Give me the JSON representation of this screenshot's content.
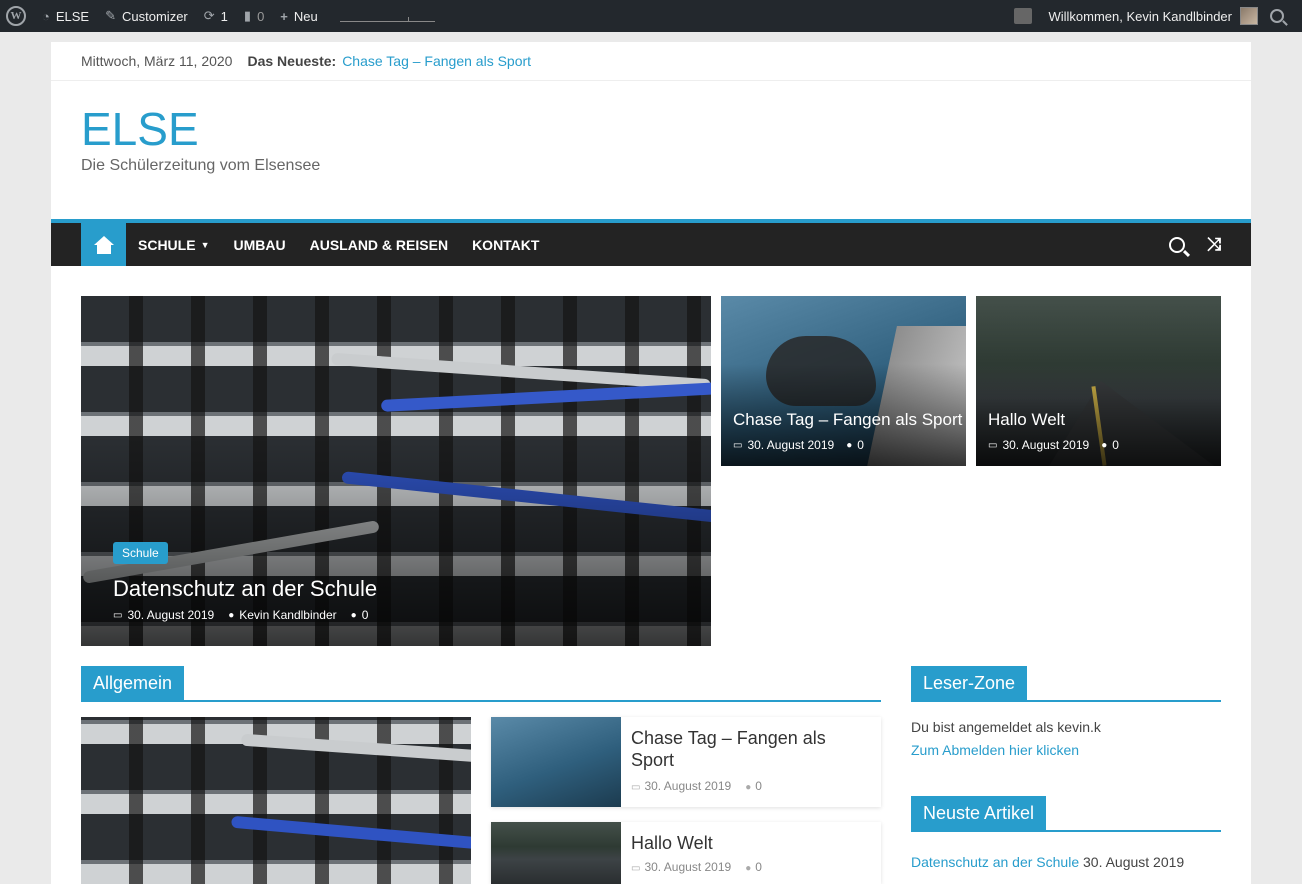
{
  "adminbar": {
    "site_name": "ELSE",
    "customizer": "Customizer",
    "updates_count": "1",
    "comments_count": "0",
    "new_label": "Neu",
    "greeting": "Willkommen, Kevin Kandlbinder"
  },
  "topbar": {
    "date": "Mittwoch, März 11, 2020",
    "news_label": "Das Neueste:",
    "news_link": "Chase Tag – Fangen als Sport"
  },
  "branding": {
    "title": "ELSE",
    "tagline": "Die Schülerzeitung vom Elsensee"
  },
  "nav": {
    "items": [
      "SCHULE",
      "UMBAU",
      "AUSLAND & REISEN",
      "KONTAKT"
    ]
  },
  "featured": {
    "main": {
      "category": "Schule",
      "title": "Datenschutz an der Schule",
      "date": "30. August 2019",
      "author": "Kevin Kandlbinder",
      "comments": "0"
    },
    "side": [
      {
        "title": "Chase Tag – Fangen als Sport",
        "date": "30. August 2019",
        "comments": "0"
      },
      {
        "title": "Hallo Welt",
        "date": "30. August 2019",
        "comments": "0"
      }
    ]
  },
  "section": {
    "title": "Allgemein",
    "posts": [
      {
        "title": "Chase Tag – Fangen als Sport",
        "date": "30. August 2019",
        "comments": "0"
      },
      {
        "title": "Hallo Welt",
        "date": "30. August 2019",
        "comments": "0"
      }
    ]
  },
  "sidebar": {
    "reader_zone_title": "Leser-Zone",
    "logged_in_text": "Du bist angemeldet als kevin.k",
    "logout_link": "Zum Abmelden hier klicken",
    "latest_title": "Neuste Artikel",
    "latest": [
      {
        "title": "Datenschutz an der Schule",
        "date": "30. August 2019"
      }
    ]
  },
  "colors": {
    "accent": "#289dcc",
    "adminbar": "#23282d",
    "nav": "#232323"
  }
}
